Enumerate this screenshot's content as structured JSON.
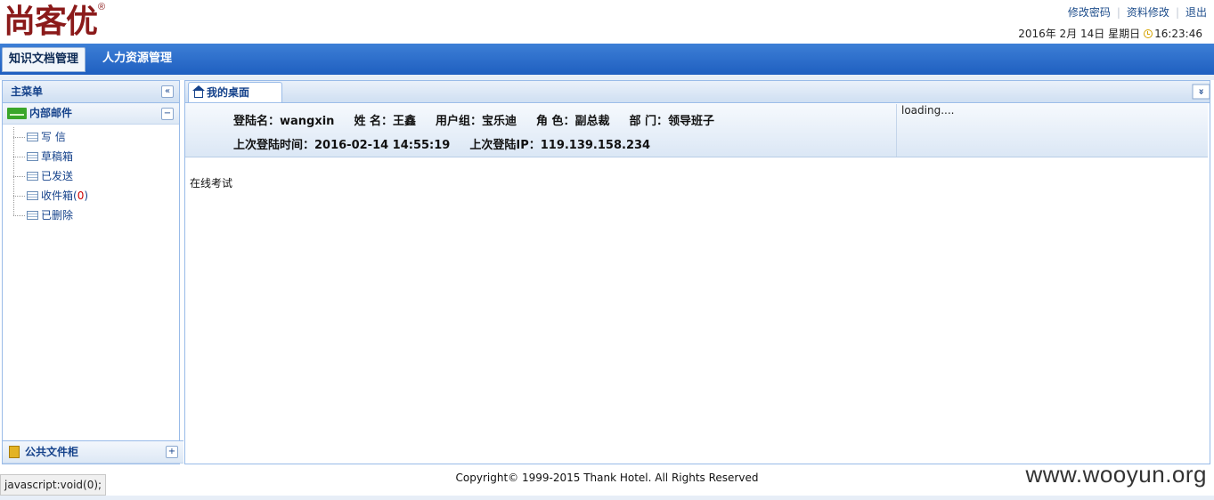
{
  "header": {
    "logo_text": "尚客优",
    "logo_mark": "®",
    "links": [
      "修改密码",
      "资料修改",
      "退出"
    ],
    "datetime": "2016年 2月 14日 星期日",
    "time": "16:23:46"
  },
  "nav": {
    "tabs": [
      "知识文档管理",
      "人力资源管理"
    ],
    "active": "知识文档管理"
  },
  "sidebar": {
    "title": "主菜单",
    "collapse_glyph": "«",
    "section_title": "内部邮件",
    "section_toggle": "−",
    "items": [
      {
        "label": "写 信"
      },
      {
        "label": "草稿箱"
      },
      {
        "label": "已发送"
      },
      {
        "label": "收件箱",
        "count_open": " (",
        "count": "0",
        "count_close": ")"
      },
      {
        "label": "已删除"
      }
    ],
    "bottom_section": "公共文件柜",
    "bottom_toggle": "+"
  },
  "main": {
    "tab_label": "我的桌面",
    "more_glyph": "»",
    "user": {
      "login_name": "登陆名：wangxin",
      "full_name": "姓 名：王鑫",
      "group": "用户组：宝乐迪",
      "role": "角 色：副总裁",
      "dept": "部 门：领导班子",
      "last_login_time": "上次登陆时间：2016-02-14 14:55:19",
      "last_login_ip": "上次登陆IP：119.139.158.234"
    },
    "loading_text": "loading....",
    "content_link": "在线考试"
  },
  "footer": {
    "copyright": "Copyright© 1999-2015 Thank Hotel. All Rights Reserved",
    "status": "javascript:void(0);",
    "watermark": "www.wooyun.org"
  }
}
